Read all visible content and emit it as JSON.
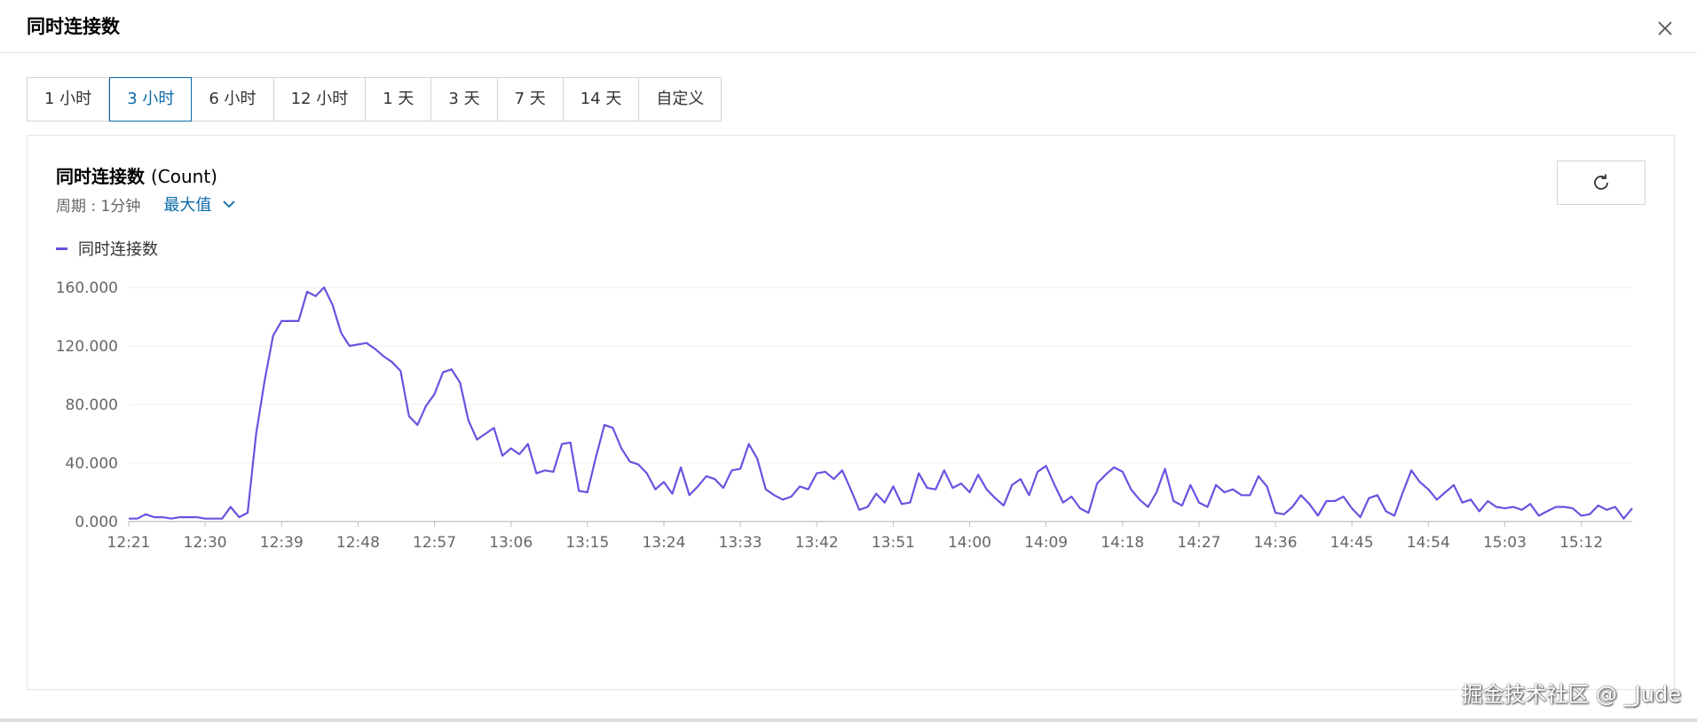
{
  "dialog": {
    "title": "同时连接数"
  },
  "time_tabs": [
    {
      "label": "1 小时",
      "active": false
    },
    {
      "label": "3 小时",
      "active": true
    },
    {
      "label": "6 小时",
      "active": false
    },
    {
      "label": "12 小时",
      "active": false
    },
    {
      "label": "1 天",
      "active": false
    },
    {
      "label": "3 天",
      "active": false
    },
    {
      "label": "7 天",
      "active": false
    },
    {
      "label": "14 天",
      "active": false
    },
    {
      "label": "自定义",
      "active": false
    }
  ],
  "panel": {
    "title": "同时连接数",
    "unit": "(Count)",
    "period": "周期 : 1分钟",
    "stat": "最大值"
  },
  "watermark": "掘金技术社区 @ _Jude",
  "colors": {
    "accent": "#0a6aa9",
    "series": "#6a52e0",
    "grid": "#ececec",
    "axis": "#bdbdbd"
  },
  "icons": {
    "close": "close-icon",
    "refresh": "refresh-icon",
    "chevron": "chevron-down-icon"
  },
  "chart_data": {
    "type": "line",
    "title": "同时连接数 (Count)",
    "legend": [
      "同时连接数"
    ],
    "legend_position": "top-left",
    "grid": true,
    "ylim": [
      0,
      160
    ],
    "y_ticks": [
      "0.000",
      "40.000",
      "80.000",
      "120.000",
      "160.000"
    ],
    "y_tick_values": [
      0,
      40,
      80,
      120,
      160
    ],
    "x_tick_labels": [
      "12:21",
      "12:30",
      "12:39",
      "12:48",
      "12:57",
      "13:06",
      "13:15",
      "13:24",
      "13:33",
      "13:42",
      "13:51",
      "14:00",
      "14:09",
      "14:18",
      "14:27",
      "14:36",
      "14:45",
      "14:54",
      "15:03",
      "15:12"
    ],
    "x_start": "12:21",
    "x_end": "15:18",
    "series": [
      {
        "name": "同时连接数",
        "values": [
          2,
          2,
          5,
          3,
          3,
          2,
          3,
          3,
          3,
          2,
          2,
          2,
          10,
          3,
          6,
          60,
          96,
          127,
          137,
          137,
          137,
          157,
          154,
          160,
          148,
          129,
          120,
          121,
          122,
          118,
          113,
          109,
          103,
          72,
          66,
          79,
          87,
          102,
          104,
          95,
          69,
          56,
          60,
          64,
          45,
          50,
          46,
          53,
          33,
          35,
          34,
          53,
          54,
          21,
          20,
          44,
          66,
          64,
          50,
          41,
          39,
          33,
          22,
          27,
          19,
          37,
          18,
          24,
          31,
          29,
          23,
          35,
          36,
          53,
          43,
          22,
          18,
          15,
          17,
          24,
          22,
          33,
          34,
          29,
          35,
          22,
          8,
          10,
          19,
          13,
          24,
          12,
          13,
          33,
          23,
          22,
          35,
          23,
          26,
          20,
          32,
          22,
          16,
          11,
          25,
          29,
          18,
          34,
          38,
          25,
          13,
          17,
          9,
          6,
          26,
          32,
          37,
          34,
          22,
          15,
          10,
          20,
          36,
          14,
          11,
          25,
          13,
          10,
          25,
          20,
          22,
          18,
          18,
          31,
          24,
          6,
          5,
          10,
          18,
          12,
          4,
          14,
          14,
          17,
          9,
          3,
          16,
          18,
          7,
          4,
          20,
          35,
          27,
          22,
          15,
          20,
          25,
          13,
          15,
          7,
          14,
          10,
          9,
          10,
          8,
          12,
          4,
          7,
          10,
          10,
          9,
          4,
          5,
          11,
          8,
          10,
          2,
          9
        ]
      }
    ]
  }
}
